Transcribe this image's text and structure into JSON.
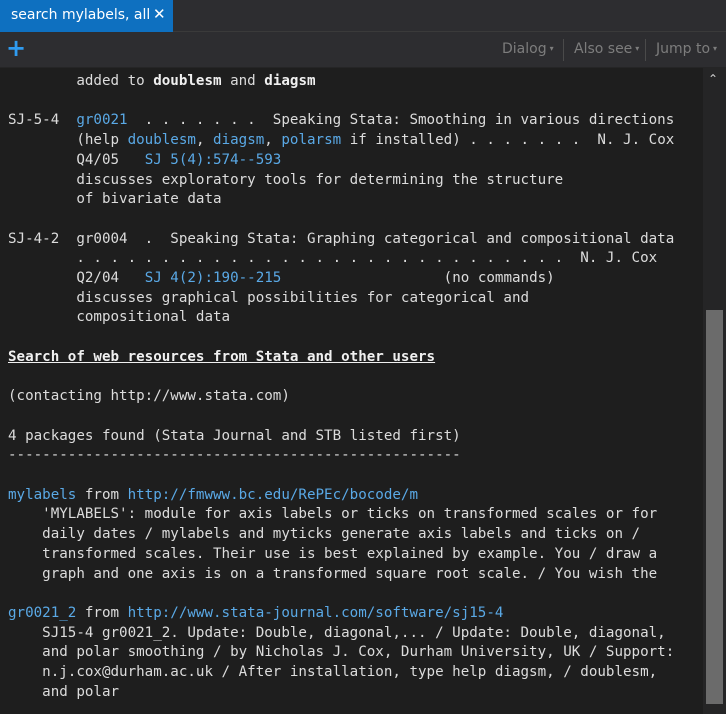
{
  "tab": {
    "title": "search mylabels, all",
    "close": "✕"
  },
  "toolbar": {
    "add": "+",
    "dialog": "Dialog",
    "also_see": "Also see",
    "jump_to": "Jump to",
    "caret": "▾"
  },
  "scrollbar": {
    "up_arrow": "⌃"
  },
  "results": {
    "intro_pre": "added to ",
    "intro_bold1": "doublesm",
    "intro_and": " and ",
    "intro_bold2": "diagsm",
    "e1": {
      "ref": "SJ-5-4",
      "id": "gr0021",
      "dots_title": "  . . . . . . .  Speaking Stata: Smoothing in various directions",
      "help_open": "(help ",
      "help1": "doublesm",
      "help2": "diagsm",
      "help3": "polarsm",
      "help_tail": " if installed) . . . . . . .  N. J. Cox",
      "issue": "Q4/05",
      "journal": "SJ 5(4):574--593",
      "desc1": "discusses exploratory tools for determining the structure",
      "desc2": "of bivariate data"
    },
    "e2": {
      "ref": "SJ-4-2",
      "line1": "gr0004  .  Speaking Stata: Graphing categorical and compositional data",
      "line2": ". . . . . . . . . . . . . . . . . . . . . . . . . . . . .  N. J. Cox",
      "issue": "Q2/04",
      "journal": "SJ 4(2):190--215",
      "nocmd": "(no commands)",
      "desc1": "discusses graphical possibilities for categorical and",
      "desc2": "compositional data"
    },
    "web_header": "Search of web resources from Stata and other users",
    "contacting": "(contacting http://www.stata.com)",
    "found": "4 packages found (Stata Journal and STB listed first)",
    "rule": "-----------------------------------------------------",
    "pkg1": {
      "name": "mylabels",
      "from_word": " from ",
      "url": "http://fmwww.bc.edu/RePEc/bocode/m",
      "lines": [
        "'MYLABELS': module for axis labels or ticks on transformed scales or for",
        "daily dates / mylabels and myticks generate axis labels and ticks on /",
        "transformed scales. Their use is best explained by example. You / draw a",
        "graph and one axis is on a transformed square root scale. / You wish the"
      ]
    },
    "pkg2": {
      "name": "gr0021_2",
      "from_word": " from ",
      "url": "http://www.stata-journal.com/software/sj15-4",
      "lines": [
        "SJ15-4 gr0021_2. Update: Double, diagonal,... / Update: Double, diagonal,",
        "and polar smoothing / by Nicholas J. Cox, Durham University, UK / Support:",
        "n.j.cox@durham.ac.uk / After installation, type help diagsm, / doublesm,",
        "and polar"
      ]
    }
  }
}
